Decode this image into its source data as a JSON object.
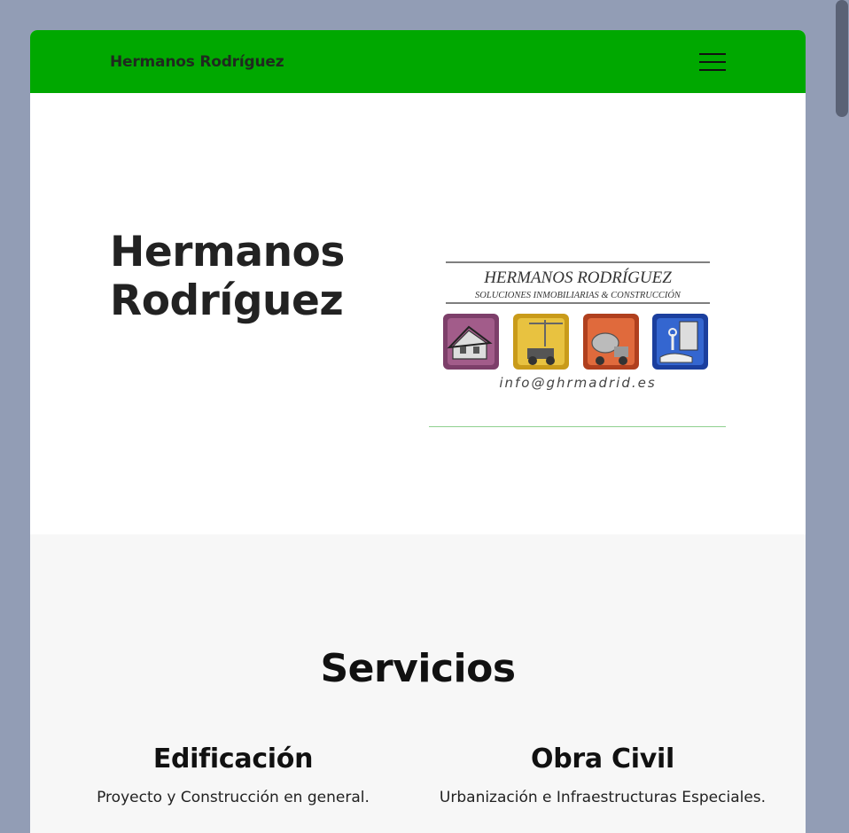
{
  "navbar": {
    "brand": "Hermanos Rodríguez",
    "menu_icon": "hamburger-menu-icon",
    "background": "#00a800"
  },
  "hero": {
    "title_line1": "Hermanos",
    "title_line2": "Rodríguez",
    "logo": {
      "line1": "HERMANOS   RODRÍGUEZ",
      "line2": "SOLUCIONES INMOBILIARIAS & CONSTRUCCIÓN",
      "email": "info@ghrmadrid.es",
      "icons": [
        "house-icon",
        "crane-roller-icon",
        "concrete-mixer-icon",
        "key-hand-icon"
      ]
    }
  },
  "services": {
    "title": "Servicios",
    "items": [
      {
        "name": "Edificación",
        "description": "Proyecto y Construcción en general."
      },
      {
        "name": "Obra Civil",
        "description": "Urbanización e Infraestructuras Especiales."
      }
    ]
  }
}
